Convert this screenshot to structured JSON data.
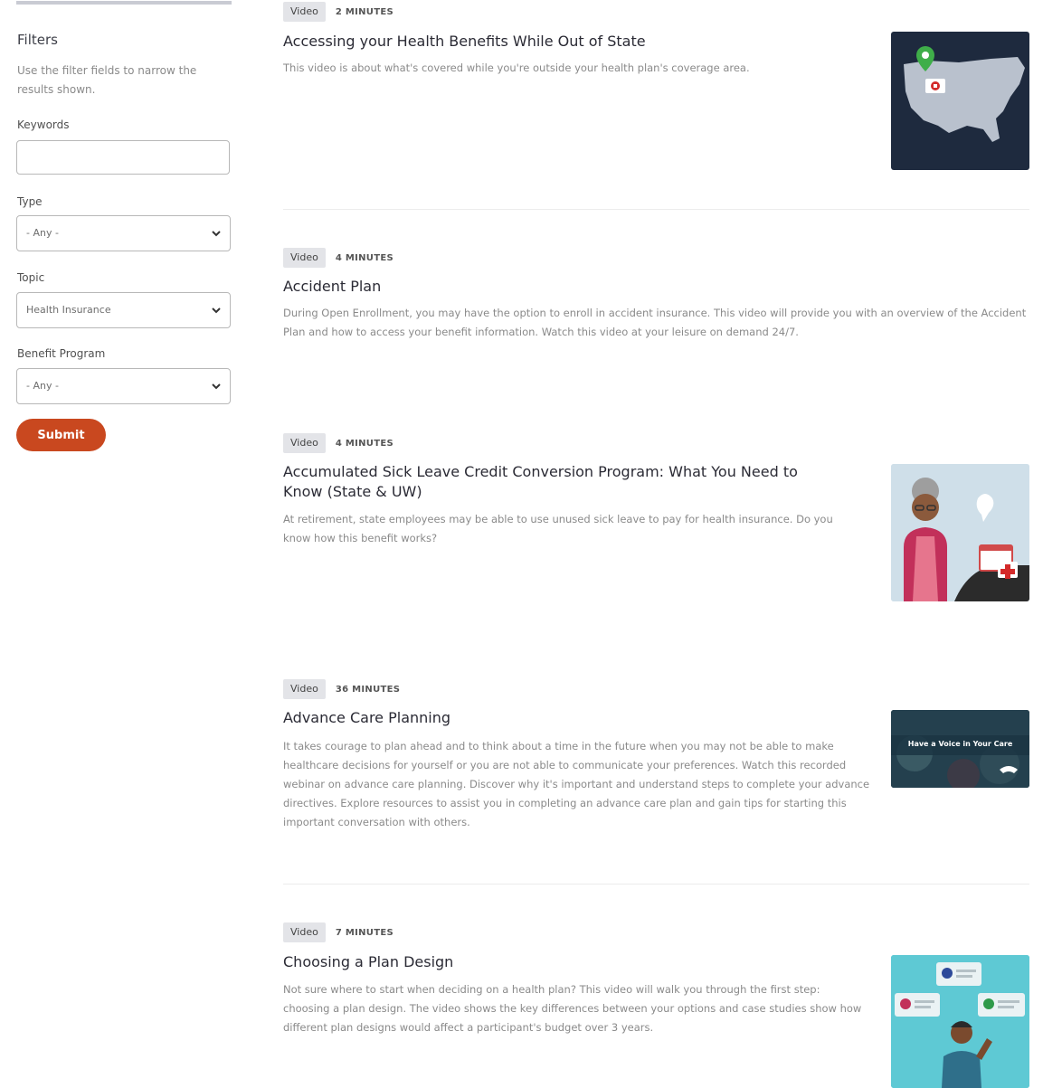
{
  "sidebar": {
    "title": "Filters",
    "description": "Use the filter fields to narrow the results shown.",
    "keywords": {
      "label": "Keywords",
      "value": "",
      "placeholder": ""
    },
    "type": {
      "label": "Type",
      "value": "- Any -"
    },
    "topic": {
      "label": "Topic",
      "value": "Health Insurance"
    },
    "benefit_program": {
      "label": "Benefit Program",
      "value": "- Any -"
    },
    "submit_label": "Submit"
  },
  "results": [
    {
      "type": "Video",
      "duration": "2 MINUTES",
      "title": "Accessing your Health Benefits While Out of State",
      "description": "This video is about what's covered while you're outside your health plan's coverage area."
    },
    {
      "type": "Video",
      "duration": "4 MINUTES",
      "title": "Accident Plan",
      "description": "During Open Enrollment, you may have the option to enroll in accident insurance. This video will provide you with an overview of the Accident Plan and how to access your benefit information. Watch this video at your leisure on demand 24/7."
    },
    {
      "type": "Video",
      "duration": "4 MINUTES",
      "title": "Accumulated Sick Leave Credit Conversion Program: What You Need to Know (State & UW)",
      "description": "At retirement, state employees may be able to use unused sick leave to pay for health insurance. Do you know how this benefit works?"
    },
    {
      "type": "Video",
      "duration": "36 MINUTES",
      "title": "Advance Care Planning",
      "description": "It takes courage to plan ahead and to think about a time in the future when you may not be able to make healthcare decisions for yourself or you are not able to communicate your preferences. Watch this recorded webinar on advance care planning. Discover why it's important and understand steps to complete your advance directives. Explore resources to assist you in completing an advance care plan and gain tips for starting this important conversation with others.",
      "thumbnail_text": "Have a Voice in Your Care"
    },
    {
      "type": "Video",
      "duration": "7 MINUTES",
      "title": "Choosing a Plan Design",
      "description": "Not sure where to start when deciding on a health plan? This video will walk you through the first step: choosing a plan design. The video shows the key differences between your options and case studies show how different plan designs would affect a participant's budget over 3 years."
    }
  ],
  "colors": {
    "accent": "#c9481f",
    "thumb_map_bg": "#1e2a3e",
    "thumb_light_bg": "#5ec9d4"
  }
}
